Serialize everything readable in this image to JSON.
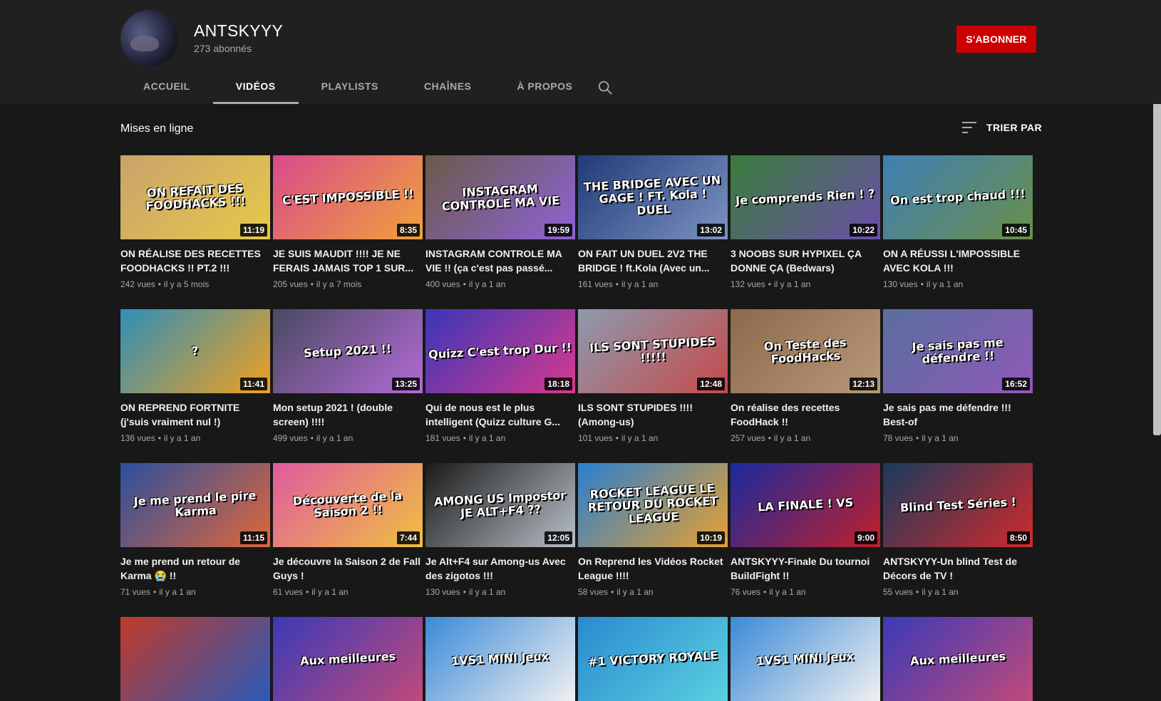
{
  "channel": {
    "name": "ANTSKYYY",
    "subscribers": "273 abonnés",
    "subscribe_label": "S'ABONNER",
    "accent": "#cc0000"
  },
  "tabs": [
    {
      "label": "ACCUEIL",
      "active": false
    },
    {
      "label": "VIDÉOS",
      "active": true
    },
    {
      "label": "PLAYLISTS",
      "active": false
    },
    {
      "label": "CHAÎNES",
      "active": false
    },
    {
      "label": "À PROPOS",
      "active": false
    }
  ],
  "section": {
    "title": "Mises en ligne",
    "sort_label": "TRIER PAR"
  },
  "videos": [
    {
      "title": "ON RÉALISE DES RECETTES FOODHACKS !! PT.2 !!!",
      "views": "242 vues",
      "age": "il y a 5 mois",
      "duration": "11:19",
      "thumb_text": "ON REFAIT DES FOODHACKS !!!",
      "color1": "#c9a36b",
      "color2": "#e6c84a"
    },
    {
      "title": "JE SUIS MAUDIT !!!! JE NE FERAIS JAMAIS TOP 1 SUR...",
      "views": "205 vues",
      "age": "il y a 7 mois",
      "duration": "8:35",
      "thumb_text": "C'EST IMPOSSIBLE !!",
      "color1": "#d94a8c",
      "color2": "#f0a23a"
    },
    {
      "title": "INSTAGRAM CONTROLE MA VIE !! (ça c'est pas passé...",
      "views": "400 vues",
      "age": "il y a 1 an",
      "duration": "19:59",
      "thumb_text": "INSTAGRAM CONTROLE MA VIE",
      "color1": "#6b5a4a",
      "color2": "#8e63d6"
    },
    {
      "title": "ON FAIT UN DUEL 2V2 THE BRIDGE ! ft.Kola (Avec un...",
      "views": "161 vues",
      "age": "il y a 1 an",
      "duration": "13:02",
      "thumb_text": "THE BRIDGE AVEC UN GAGE ! FT. Kola ! DUEL",
      "color1": "#1f3b78",
      "color2": "#7d93c2"
    },
    {
      "title": "3 NOOBS SUR HYPIXEL ÇA DONNE ÇA (Bedwars)",
      "views": "132 vues",
      "age": "il y a 1 an",
      "duration": "10:22",
      "thumb_text": "Je comprends Rien ! ?",
      "color1": "#3a7d3a",
      "color2": "#6a4fa8"
    },
    {
      "title": "ON A RÉUSSI L'IMPOSSIBLE AVEC KOLA !!!",
      "views": "130 vues",
      "age": "il y a 1 an",
      "duration": "10:45",
      "thumb_text": "On est trop chaud !!!",
      "color1": "#3f7fb5",
      "color2": "#6a8f4a"
    },
    {
      "title": "ON REPREND FORTNITE (j'suis vraiment nul !)",
      "views": "136 vues",
      "age": "il y a 1 an",
      "duration": "11:41",
      "thumb_text": "?",
      "color1": "#2e8fb8",
      "color2": "#f0a020"
    },
    {
      "title": "Mon setup 2021 ! (double screen) !!!!",
      "views": "499 vues",
      "age": "il y a 1 an",
      "duration": "13:25",
      "thumb_text": "Setup 2021 !!",
      "color1": "#4a4a62",
      "color2": "#b36ad6"
    },
    {
      "title": "Qui de nous est le plus intelligent (Quizz culture G...",
      "views": "181 vues",
      "age": "il y a 1 an",
      "duration": "18:18",
      "thumb_text": "Quizz C'est trop Dur !!",
      "color1": "#3a36b8",
      "color2": "#d63a8e"
    },
    {
      "title": "ILS SONT STUPIDES !!!! (Among-us)",
      "views": "101 vues",
      "age": "il y a 1 an",
      "duration": "12:48",
      "thumb_text": "ILS SONT STUPIDES !!!!!",
      "color1": "#8e9ab0",
      "color2": "#c44a4a"
    },
    {
      "title": "On réalise des recettes FoodHack !!",
      "views": "257 vues",
      "age": "il y a 1 an",
      "duration": "12:13",
      "thumb_text": "On Teste des FoodHacks",
      "color1": "#8a6a4a",
      "color2": "#b89878"
    },
    {
      "title": "Je sais pas me défendre !!! Best-of",
      "views": "78 vues",
      "age": "il y a 1 an",
      "duration": "16:52",
      "thumb_text": "Je sais pas me défendre !!",
      "color1": "#5a6e9e",
      "color2": "#8e5ab8"
    },
    {
      "title": "Je me prend un retour de Karma 😭 !!",
      "views": "71 vues",
      "age": "il y a 1 an",
      "duration": "11:15",
      "thumb_text": "Je me prend le pire Karma",
      "color1": "#2a4f9e",
      "color2": "#e0673a"
    },
    {
      "title": "Je découvre la Saison 2 de Fall Guys !",
      "views": "61 vues",
      "age": "il y a 1 an",
      "duration": "7:44",
      "thumb_text": "Découverte de la Saison 2 !!",
      "color1": "#e05a9e",
      "color2": "#f0c040"
    },
    {
      "title": "Je Alt+F4 sur Among-us Avec des zigotos !!!",
      "views": "130 vues",
      "age": "il y a 1 an",
      "duration": "12:05",
      "thumb_text": "AMONG US Impostor JE ALT+F4 ??",
      "color1": "#1a1a1a",
      "color2": "#b8c0c8"
    },
    {
      "title": "On Reprend les Vidéos Rocket League !!!!",
      "views": "58 vues",
      "age": "il y a 1 an",
      "duration": "10:19",
      "thumb_text": "ROCKET LEAGUE LE RETOUR DU ROCKET LEAGUE",
      "color1": "#2a7fd0",
      "color2": "#e8a030"
    },
    {
      "title": "ANTSKYYY-Finale Du tournoi BuildFight !!",
      "views": "76 vues",
      "age": "il y a 1 an",
      "duration": "9:00",
      "thumb_text": "LA FINALE ! VS",
      "color1": "#1a2a9e",
      "color2": "#c0202a"
    },
    {
      "title": "ANTSKYYY-Un blind Test de Décors de TV !",
      "views": "55 vues",
      "age": "il y a 1 an",
      "duration": "8:50",
      "thumb_text": "Blind Test Séries !",
      "color1": "#1a3a5e",
      "color2": "#d02a2a"
    },
    {
      "title": "",
      "views": "",
      "age": "",
      "duration": "",
      "thumb_text": "",
      "color1": "#c03a2a",
      "color2": "#2a5ab8"
    },
    {
      "title": "",
      "views": "",
      "age": "",
      "duration": "",
      "thumb_text": "Aux meilleures",
      "color1": "#3a3ab8",
      "color2": "#c04a7a"
    },
    {
      "title": "",
      "views": "",
      "age": "",
      "duration": "",
      "thumb_text": "1VS1 MINI Jeux",
      "color1": "#3a8ad8",
      "color2": "#f0f0f0"
    },
    {
      "title": "",
      "views": "",
      "age": "",
      "duration": "",
      "thumb_text": "#1 VICTORY ROYALE",
      "color1": "#2a8ad0",
      "color2": "#5ad0e0"
    },
    {
      "title": "",
      "views": "",
      "age": "",
      "duration": "",
      "thumb_text": "1VS1 MINI Jeux",
      "color1": "#3a8ad8",
      "color2": "#f0f0f0"
    },
    {
      "title": "",
      "views": "",
      "age": "",
      "duration": "",
      "thumb_text": "Aux meilleures",
      "color1": "#3a3ab8",
      "color2": "#c04a7a"
    }
  ]
}
